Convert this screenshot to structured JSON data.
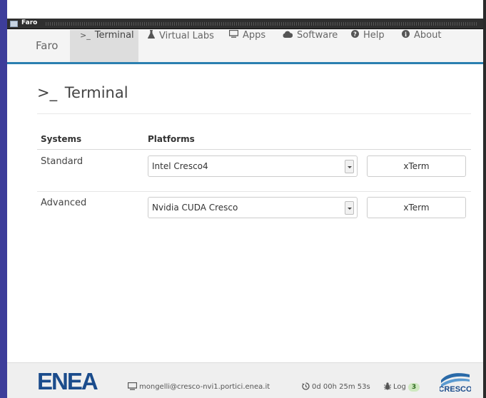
{
  "window": {
    "title": "Faro"
  },
  "navbar": {
    "brand": "Faro",
    "items": [
      {
        "label": "Terminal",
        "icon": "terminal-icon",
        "active": true
      },
      {
        "label": "Virtual Labs",
        "icon": "flask-icon"
      },
      {
        "label": "Apps",
        "icon": "monitor-icon"
      },
      {
        "label": "Software",
        "icon": "cloud-icon"
      },
      {
        "label": "Help",
        "icon": "question-circle-icon"
      },
      {
        "label": "About",
        "icon": "info-circle-icon"
      }
    ],
    "accent_color": "#2b7fb0"
  },
  "page": {
    "title": "Terminal",
    "title_prompt": ">_"
  },
  "table": {
    "headers": {
      "systems": "Systems",
      "platforms": "Platforms"
    },
    "rows": [
      {
        "system": "Standard",
        "platform": "Intel Cresco4",
        "action": "xTerm"
      },
      {
        "system": "Advanced",
        "platform": "Nvidia CUDA Cresco",
        "action": "xTerm"
      }
    ]
  },
  "footer": {
    "logo_left": "ENEA",
    "host": "mongelli@cresco-nvi1.portici.enea.it",
    "session_time": "0d 00h 25m 53s",
    "log_label": "Log",
    "log_count": "3",
    "logo_right": "CRESCO"
  }
}
